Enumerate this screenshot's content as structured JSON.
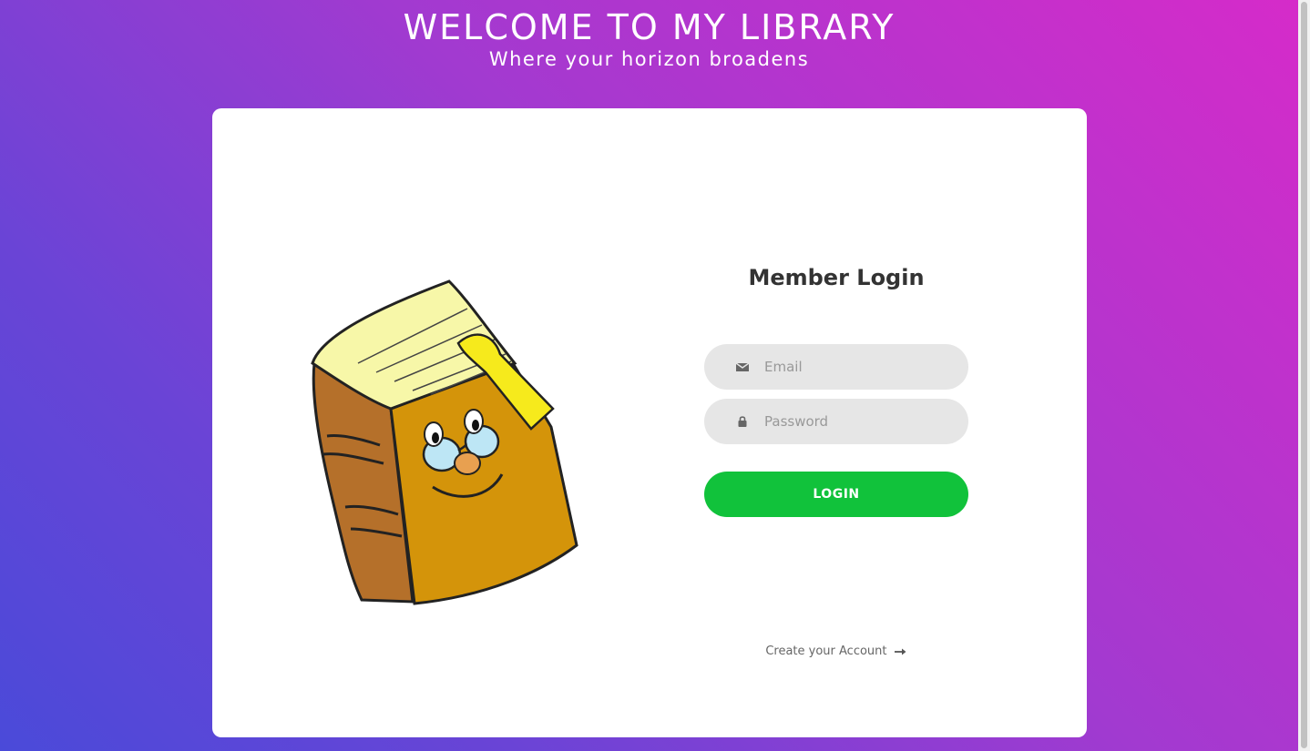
{
  "header": {
    "title": "WELCOME TO MY LIBRARY",
    "subtitle": "Where your horizon broadens"
  },
  "login": {
    "title": "Member Login",
    "email_placeholder": "Email",
    "password_placeholder": "Password",
    "button_label": "LOGIN",
    "create_account_label": "Create your Account"
  },
  "icons": {
    "email": "envelope-icon",
    "password": "lock-icon",
    "create_account": "long-arrow-right-icon",
    "illustration": "cartoon-book-with-glasses"
  },
  "colors": {
    "gradient_start": "#d62bc9",
    "gradient_end": "#4a4ad9",
    "card": "#ffffff",
    "field_background": "#e6e6e6",
    "login_button": "#11c23b",
    "title_text": "#333333"
  }
}
